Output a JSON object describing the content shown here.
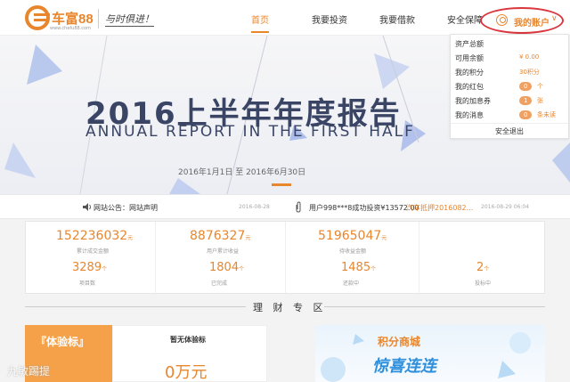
{
  "header": {
    "logo_text": "车富88",
    "logo_url": "www.chefu88.com",
    "slogan": "与时俱进！",
    "nav": [
      "首页",
      "我要投资",
      "我要借款",
      "安全保障"
    ],
    "account_label": "我的账户",
    "account_chevron": "∨"
  },
  "dropdown": {
    "rows": [
      {
        "label": "资产总额",
        "value": ""
      },
      {
        "label": "可用余额",
        "value": "¥ 0.00"
      },
      {
        "label": "我的积分",
        "value": "30积分"
      },
      {
        "label": "我的红包",
        "badge": "0",
        "badge_text": "个"
      },
      {
        "label": "我的加息券",
        "badge": "1",
        "badge_text": "张"
      },
      {
        "label": "我的消息",
        "badge": "0",
        "badge_text": "条未读"
      }
    ],
    "logout": "安全退出"
  },
  "banner": {
    "title": "2016上半年年度报告",
    "subtitle": "ANNUAL REPORT IN THE FIRST HALF",
    "date": "2016年1月1日 至 2016年6月30日"
  },
  "notice": {
    "label": "网站公告：网站声明",
    "date1": "2016-08-28",
    "invest": "用户998***8成功投资¥13572.00",
    "invest_link": "汽车抵押2016082...",
    "date2": "2016-08-29 06:04"
  },
  "stats": [
    {
      "big": "152236032",
      "unit": "元",
      "cap": "累计成交金额",
      "num2": "3289",
      "unit2": "个",
      "cap2": "项目数"
    },
    {
      "big": "8876327",
      "unit": "元",
      "cap": "用户累计收益",
      "num2": "1804",
      "unit2": "个",
      "cap2": "已完成"
    },
    {
      "big": "51965047",
      "unit": "元",
      "cap": "待收益金额",
      "num2": "1485",
      "unit2": "个",
      "cap2": "还款中"
    },
    {
      "big": "",
      "unit": "",
      "cap": "",
      "num2": "2",
      "unit2": "个",
      "cap2": "投标中"
    }
  ],
  "zone": {
    "title": "理 财 专 区"
  },
  "cards": {
    "left_title": "『体验标』",
    "mid_title": "暂无体验标",
    "mid_amount": "0万元",
    "right_t1": "积分商城",
    "right_t2": "惊喜连连"
  },
  "watermark": "九敏踢提",
  "colors": {
    "accent": "#e8862d",
    "highlight_ring": "#d9363e",
    "banner_text": "#3a4566"
  }
}
